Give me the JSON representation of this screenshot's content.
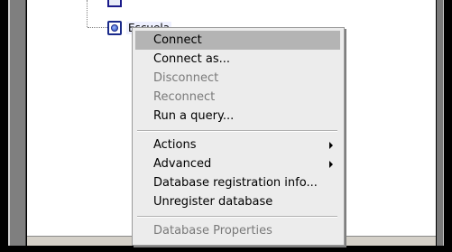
{
  "tree": {
    "prev_label": "",
    "node_label": "Escuela"
  },
  "menu": {
    "items": [
      {
        "label": "Connect",
        "enabled": true,
        "highlighted": true
      },
      {
        "label": "Connect as...",
        "enabled": true
      },
      {
        "label": "Disconnect",
        "enabled": false
      },
      {
        "label": "Reconnect",
        "enabled": false
      },
      {
        "label": "Run a query...",
        "enabled": true
      },
      {
        "label": "Actions",
        "enabled": true,
        "submenu": true
      },
      {
        "label": "Advanced",
        "enabled": true,
        "submenu": true
      },
      {
        "label": "Database registration info...",
        "enabled": true
      },
      {
        "label": "Unregister database",
        "enabled": true
      },
      {
        "label": "Database Properties",
        "enabled": false
      }
    ]
  },
  "colors": {
    "highlight": "#b4b4b4",
    "disabled_text": "#7a7a7a",
    "menu_bg": "#ececec"
  }
}
